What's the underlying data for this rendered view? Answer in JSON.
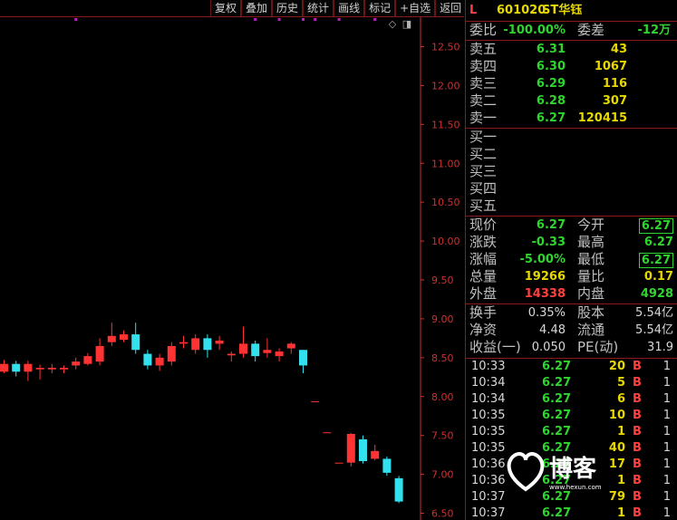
{
  "toolbar": {
    "buttons": [
      "复权",
      "叠加",
      "历史",
      "统计",
      "画线",
      "标记",
      "+自选",
      "返回"
    ]
  },
  "header": {
    "flag": "L",
    "code": "601020",
    "name": "ST华钰"
  },
  "order_ratio": {
    "wb_label": "委比",
    "wb_value": "-100.00%",
    "wc_label": "委差",
    "wc_value": "-12万"
  },
  "ask": [
    {
      "label": "卖五",
      "price": "6.31",
      "vol": "43"
    },
    {
      "label": "卖四",
      "price": "6.30",
      "vol": "1067"
    },
    {
      "label": "卖三",
      "price": "6.29",
      "vol": "116"
    },
    {
      "label": "卖二",
      "price": "6.28",
      "vol": "307"
    },
    {
      "label": "卖一",
      "price": "6.27",
      "vol": "120415"
    }
  ],
  "bid": [
    {
      "label": "买一"
    },
    {
      "label": "买二"
    },
    {
      "label": "买三"
    },
    {
      "label": "买四"
    },
    {
      "label": "买五"
    }
  ],
  "quote": [
    {
      "l1": "现价",
      "v1": "6.27",
      "c1": "g",
      "l2": "今开",
      "v2": "6.27",
      "c2": "g",
      "box2": true
    },
    {
      "l1": "涨跌",
      "v1": "-0.33",
      "c1": "g",
      "l2": "最高",
      "v2": "6.27",
      "c2": "g",
      "box2": false
    },
    {
      "l1": "涨幅",
      "v1": "-5.00%",
      "c1": "g",
      "l2": "最低",
      "v2": "6.27",
      "c2": "g",
      "box2": true
    },
    {
      "l1": "总量",
      "v1": "19266",
      "c1": "y",
      "l2": "量比",
      "v2": "0.17",
      "c2": "y",
      "box2": false
    },
    {
      "l1": "外盘",
      "v1": "14338",
      "c1": "r",
      "l2": "内盘",
      "v2": "4928",
      "c2": "g",
      "box2": false
    }
  ],
  "fundamentals": [
    {
      "l1": "换手",
      "v1": "0.35%",
      "l2": "股本",
      "v2": "5.54亿"
    },
    {
      "l1": "净资",
      "v1": "4.48",
      "l2": "流通",
      "v2": "5.54亿"
    },
    {
      "l1": "收益(一)",
      "v1": "0.050",
      "l2": "PE(动)",
      "v2": "31.9"
    }
  ],
  "ticks": [
    {
      "time": "10:33",
      "price": "6.27",
      "vol": "20",
      "side": "B",
      "n": "1"
    },
    {
      "time": "10:34",
      "price": "6.27",
      "vol": "5",
      "side": "B",
      "n": "1"
    },
    {
      "time": "10:34",
      "price": "6.27",
      "vol": "6",
      "side": "B",
      "n": "1"
    },
    {
      "time": "10:35",
      "price": "6.27",
      "vol": "10",
      "side": "B",
      "n": "1"
    },
    {
      "time": "10:35",
      "price": "6.27",
      "vol": "1",
      "side": "B",
      "n": "1"
    },
    {
      "time": "10:35",
      "price": "6.27",
      "vol": "40",
      "side": "B",
      "n": "1"
    },
    {
      "time": "10:36",
      "price": "6.27",
      "vol": "17",
      "side": "B",
      "n": "1"
    },
    {
      "time": "10:36",
      "price": "6.27",
      "vol": "1",
      "side": "B",
      "n": "1"
    },
    {
      "time": "10:37",
      "price": "6.27",
      "vol": "79",
      "side": "B",
      "n": "1"
    },
    {
      "time": "10:37",
      "price": "6.27",
      "vol": "1",
      "side": "B",
      "n": "1"
    }
  ],
  "chart_icons": [
    "diamond-icon",
    "window-icon"
  ],
  "watermark": {
    "text": "博客",
    "subtext": "www.hexun.com"
  },
  "colors": {
    "up": "#ff3333",
    "down": "#33e0ee",
    "axis": "#d03030",
    "marker": "#c020c0"
  },
  "chart_data": {
    "type": "candlestick",
    "y_ticks": [
      "12.50",
      "12.00",
      "11.50",
      "11.00",
      "10.50",
      "10.00",
      "9.50",
      "9.00",
      "8.50",
      "8.00",
      "7.50",
      "7.00",
      "6.50"
    ],
    "ylim": [
      6.45,
      12.85
    ],
    "candles": [
      {
        "o": 8.32,
        "c": 8.42,
        "h": 8.47,
        "l": 8.3
      },
      {
        "o": 8.42,
        "c": 8.32,
        "h": 8.46,
        "l": 8.26
      },
      {
        "o": 8.32,
        "c": 8.42,
        "h": 8.46,
        "l": 8.2
      },
      {
        "o": 8.35,
        "c": 8.37,
        "h": 8.41,
        "l": 8.22
      },
      {
        "o": 8.35,
        "c": 8.37,
        "h": 8.42,
        "l": 8.3
      },
      {
        "o": 8.35,
        "c": 8.37,
        "h": 8.4,
        "l": 8.3
      },
      {
        "o": 8.4,
        "c": 8.45,
        "h": 8.5,
        "l": 8.35
      },
      {
        "o": 8.42,
        "c": 8.52,
        "h": 8.56,
        "l": 8.4
      },
      {
        "o": 8.45,
        "c": 8.65,
        "h": 8.75,
        "l": 8.4
      },
      {
        "o": 8.7,
        "c": 8.78,
        "h": 8.95,
        "l": 8.65
      },
      {
        "o": 8.73,
        "c": 8.8,
        "h": 8.85,
        "l": 8.7
      },
      {
        "o": 8.8,
        "c": 8.6,
        "h": 8.95,
        "l": 8.55
      },
      {
        "o": 8.55,
        "c": 8.4,
        "h": 8.6,
        "l": 8.35
      },
      {
        "o": 8.4,
        "c": 8.5,
        "h": 8.55,
        "l": 8.33
      },
      {
        "o": 8.45,
        "c": 8.65,
        "h": 8.7,
        "l": 8.4
      },
      {
        "o": 8.68,
        "c": 8.7,
        "h": 8.78,
        "l": 8.62
      },
      {
        "o": 8.6,
        "c": 8.75,
        "h": 8.8,
        "l": 8.55
      },
      {
        "o": 8.75,
        "c": 8.6,
        "h": 8.8,
        "l": 8.5
      },
      {
        "o": 8.68,
        "c": 8.72,
        "h": 8.78,
        "l": 8.6
      },
      {
        "o": 8.53,
        "c": 8.55,
        "h": 8.58,
        "l": 8.45
      },
      {
        "o": 8.55,
        "c": 8.68,
        "h": 8.9,
        "l": 8.5
      },
      {
        "o": 8.68,
        "c": 8.52,
        "h": 8.72,
        "l": 8.45
      },
      {
        "o": 8.56,
        "c": 8.6,
        "h": 8.75,
        "l": 8.5
      },
      {
        "o": 8.52,
        "c": 8.58,
        "h": 8.62,
        "l": 8.45
      },
      {
        "o": 8.62,
        "c": 8.68,
        "h": 8.7,
        "l": 8.55
      },
      {
        "o": 8.6,
        "c": 8.4,
        "h": 8.6,
        "l": 8.3
      },
      {
        "o": 7.94,
        "c": 7.94,
        "h": 7.94,
        "l": 7.94
      },
      {
        "o": 7.54,
        "c": 7.54,
        "h": 7.54,
        "l": 7.54
      },
      {
        "o": 7.15,
        "c": 7.15,
        "h": 7.15,
        "l": 7.15
      },
      {
        "o": 7.15,
        "c": 7.52,
        "h": 7.53,
        "l": 7.1
      },
      {
        "o": 7.45,
        "c": 7.17,
        "h": 7.5,
        "l": 7.14
      },
      {
        "o": 7.2,
        "c": 7.3,
        "h": 7.38,
        "l": 7.18
      },
      {
        "o": 7.2,
        "c": 7.02,
        "h": 7.23,
        "l": 6.98
      },
      {
        "o": 6.95,
        "c": 6.65,
        "h": 6.98,
        "l": 6.63
      }
    ],
    "marker_columns": [
      6,
      21,
      23,
      25,
      26,
      28,
      31
    ],
    "marker_price": 12.85
  }
}
